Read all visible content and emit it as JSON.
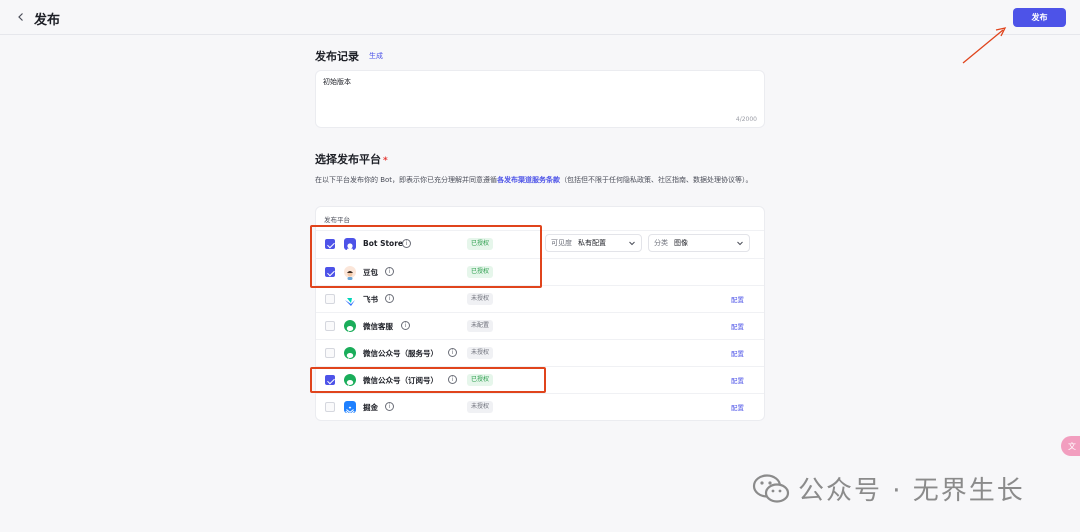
{
  "header": {
    "title": "发布",
    "publish_label": "发布"
  },
  "record": {
    "title": "发布记录",
    "generate_label": "生成",
    "value": "初始版本",
    "count": "4/2000"
  },
  "platforms": {
    "title": "选择发布平台",
    "required": "*",
    "desc_before": "在以下平台发布你的 Bot，即表示你已充分理解并同意遵循",
    "desc_link": "各发布渠道服务条款",
    "desc_after": "（包括但不限于任何隐私政策、社区指南、数据处理协议等）。",
    "column_header": "发布平台",
    "rows": [
      {
        "name": "Bot Store",
        "status": "已授权",
        "status_type": "ok",
        "checked": true,
        "config": "",
        "visibility_label": "可见度",
        "visibility_value": "私有配置",
        "category_label": "分类",
        "category_value": "图像"
      },
      {
        "name": "豆包",
        "status": "已授权",
        "status_type": "ok",
        "checked": true,
        "config": ""
      },
      {
        "name": "飞书",
        "status": "未授权",
        "status_type": "no",
        "checked": false,
        "config": "配置"
      },
      {
        "name": "微信客服",
        "status": "未配置",
        "status_type": "no",
        "checked": false,
        "config": "配置"
      },
      {
        "name": "微信公众号（服务号）",
        "status": "未授权",
        "status_type": "no",
        "checked": false,
        "config": "配置"
      },
      {
        "name": "微信公众号（订阅号）",
        "status": "已授权",
        "status_type": "ok",
        "checked": true,
        "config": "配置"
      },
      {
        "name": "掘金",
        "status": "未授权",
        "status_type": "no",
        "checked": false,
        "config": "配置"
      }
    ]
  },
  "colors": {
    "accent": "#4d53e8",
    "annotation": "#e0441c",
    "authorized_bg": "#e6f6eb",
    "authorized_text": "#2a9d4b"
  },
  "float_button": "文",
  "watermark": "公众号 · 无界生长"
}
